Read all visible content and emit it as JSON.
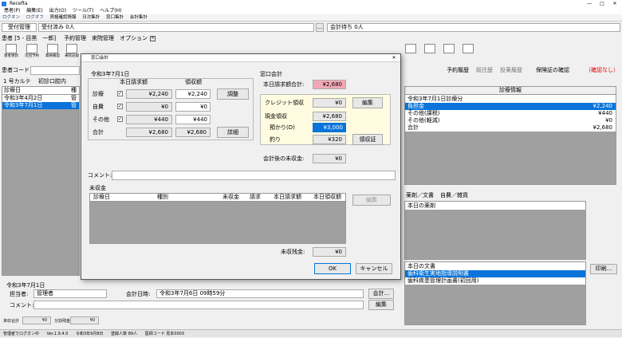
{
  "window": {
    "title": "Recefta"
  },
  "menu": [
    "患者(P)",
    "編集(E)",
    "出力(O)",
    "ツール(T)",
    "ヘルプ(H)"
  ],
  "quick_toolbar": [
    "ログオン",
    "ログオフ",
    "資格確認情報",
    "日次集計",
    "窓口集計",
    "会計集計"
  ],
  "tabs": {
    "reception": "受付管理",
    "reception_done": "受付済み 0人",
    "accounting_wait": "会計待ち 0人"
  },
  "patient": {
    "header": "患者 [5 - 目黒　一郎]",
    "code_label": "患者コード"
  },
  "nav_tabs": [
    "予約管理",
    "来院管理",
    "オプション"
  ],
  "toolbar_icons": [
    {
      "label": "患者更新",
      "icon": "patient-update-icon"
    },
    {
      "label": "次回予約",
      "icon": "next-appointment-icon"
    },
    {
      "label": "資格確認",
      "icon": "qualification-check-icon"
    },
    {
      "label": "来院記録",
      "icon": "visit-record-icon"
    }
  ],
  "right_links": {
    "history": "予約履歴",
    "past": "既往歴",
    "medication": "投薬履歴",
    "insurance": "保険証の確認",
    "insurance_status": "（確認なし）"
  },
  "karte": {
    "tab": "1 号カルテ",
    "tab2": "初診口腔内",
    "col_date": "診療日",
    "col_kind": "種",
    "rows": [
      {
        "date": "令和3年4月2日",
        "kind": "管"
      },
      {
        "date": "令和3年7月1日",
        "kind": "管"
      }
    ]
  },
  "dialog": {
    "title": "窓口会計",
    "date": "令和3年7月1日",
    "billed_header": "本日請求額",
    "received_header": "領収額",
    "rows": [
      {
        "label": "診療",
        "checked": true,
        "billed": "¥2,240",
        "received": "¥2,240"
      },
      {
        "label": "自費",
        "checked": true,
        "billed": "¥0",
        "received": "¥0"
      },
      {
        "label": "その他",
        "checked": true,
        "billed": "¥440",
        "received": "¥440"
      },
      {
        "label": "合計",
        "checked": false,
        "billed": "¥2,680",
        "received": "¥2,680"
      }
    ],
    "adjust_btn": "調整",
    "detail_btn": "詳細",
    "window_section": "窓口会計",
    "today_total_label": "本日請求額合計:",
    "today_total": "¥2,680",
    "credit_label": "クレジット領収",
    "credit_value": "¥0",
    "edit_btn": "編集",
    "cash_label": "現金領収",
    "cash_value": "¥2,680",
    "deposit_label": "預かり(D)",
    "deposit_value": "¥3,000",
    "change_label": "釣り",
    "change_value": "¥320",
    "receipt_btn": "領収証",
    "unpaid_after_label": "会計後の未収金:",
    "unpaid_after": "¥0",
    "comment_label": "コメント:",
    "unpaid_section": "未収金",
    "unpaid_cols": [
      "診療日",
      "種別",
      "未収金",
      "請求",
      "本日請求額",
      "本日領収額"
    ],
    "unpaid_edit_btn": "編集",
    "unpaid_balance_label": "未収残金:",
    "unpaid_balance": "¥0",
    "ok_btn": "OK",
    "cancel_btn": "キャンセル"
  },
  "bottom": {
    "date": "令和3年7月1日",
    "staff_label": "担当者:",
    "staff_value": "管理者",
    "account_time_label": "会計日時:",
    "account_time_value": "令和3年7月6日 09時59分",
    "comment_label": "コメント:",
    "account_btn": "会計...",
    "edit_btn": "編集",
    "unpaid_total_label": "未収合計",
    "unpaid_total_value": "¥0",
    "installment_label": "分割残金",
    "installment_value": "¥0"
  },
  "info_panel": {
    "header": "診療情報",
    "sub": "令和3年7月1日診療分",
    "rows": [
      {
        "label": "負担金",
        "value": "¥2,240",
        "selected": true
      },
      {
        "label": "その他(課税)",
        "value": "¥440",
        "selected": false
      },
      {
        "label": "その他(軽減)",
        "value": "¥0",
        "selected": false
      },
      {
        "label": "合計",
        "value": "¥2,680",
        "selected": false
      }
    ]
  },
  "docs": {
    "tab1": "薬剤／文書",
    "tab2": "自費／雑貨",
    "today_meds": "本日の薬剤",
    "today_docs": "本日の文書",
    "doc_items": [
      {
        "label": "歯科衛生実地指導説明書",
        "selected": true
      },
      {
        "label": "歯科疾患管理計画書(初回用)",
        "selected": false
      }
    ],
    "print_btn": "印刷..."
  },
  "statusbar": {
    "user": "管理者でログオン中",
    "version": "Ver.1.9.4.0",
    "date": "令和3年9月8日",
    "registered": "登録人数 89人",
    "facility": "医師コード 見本0003"
  }
}
